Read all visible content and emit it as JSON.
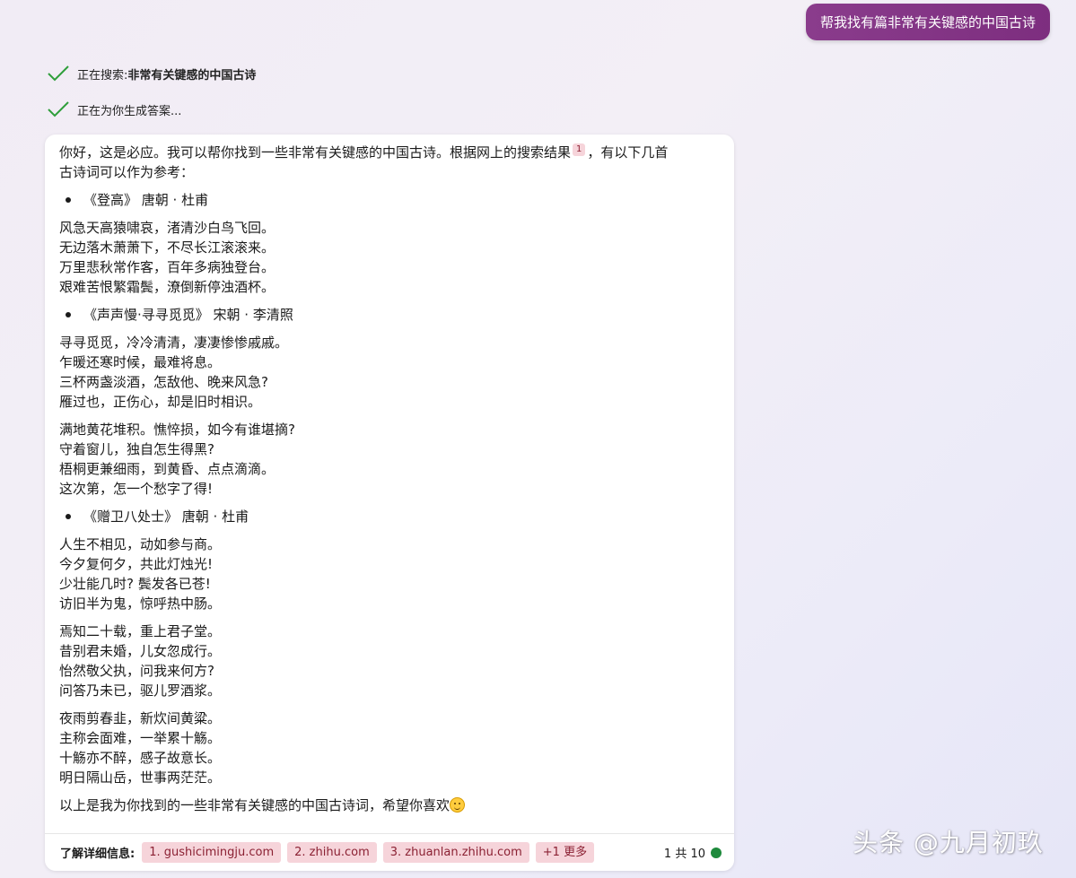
{
  "user_message": "帮我找有篇非常有关键感的中国古诗",
  "status": [
    {
      "prefix": "正在搜索: ",
      "bold": "非常有关键感的中国古诗"
    },
    {
      "prefix": "正在为你生成答案...",
      "bold": ""
    }
  ],
  "answer": {
    "intro_a": "你好，这是必应。我可以帮你找到一些非常有关键感的中国古诗。根据网上的搜索结果",
    "intro_ref": "1",
    "intro_b": "，有以下几首",
    "intro_c": "古诗词可以作为参考：",
    "poems": [
      {
        "heading": "《登高》 唐朝 · 杜甫",
        "stanzas": [
          [
            "风急天高猿啸哀，渚清沙白鸟飞回。",
            "无边落木萧萧下，不尽长江滚滚来。",
            "万里悲秋常作客，百年多病独登台。",
            "艰难苦恨繁霜鬓，潦倒新停浊酒杯。"
          ]
        ]
      },
      {
        "heading": "《声声慢·寻寻觅觅》 宋朝 · 李清照",
        "stanzas": [
          [
            "寻寻觅觅，冷冷清清，凄凄惨惨戚戚。",
            "乍暖还寒时候，最难将息。",
            "三杯两盏淡酒，怎敌他、晚来风急?",
            "雁过也，正伤心，却是旧时相识。"
          ],
          [
            "满地黄花堆积。憔悴损，如今有谁堪摘?",
            "守着窗儿，独自怎生得黑?",
            "梧桐更兼细雨，到黄昏、点点滴滴。",
            "这次第，怎一个愁字了得!"
          ]
        ]
      },
      {
        "heading": "《赠卫八处士》 唐朝 · 杜甫",
        "stanzas": [
          [
            "人生不相见，动如参与商。",
            "今夕复何夕，共此灯烛光!",
            "少壮能几时? 鬓发各已苍!",
            "访旧半为鬼，惊呼热中肠。"
          ],
          [
            "焉知二十载，重上君子堂。",
            "昔别君未婚，儿女忽成行。",
            "怡然敬父执，问我来何方?",
            "问答乃未已，驱儿罗酒浆。"
          ],
          [
            "夜雨剪春韭，新炊间黄粱。",
            "主称会面难，一举累十觞。",
            "十觞亦不醉，感子故意长。",
            "明日隔山岳，世事两茫茫。"
          ]
        ]
      }
    ],
    "closing": "以上是我为你找到的一些非常有关键感的中国古诗词，希望你喜欢"
  },
  "footer": {
    "label": "了解详细信息:",
    "sources": [
      "1. gushicimingju.com",
      "2. zhihu.com",
      "3. zhuanlan.zhihu.com",
      "+1 更多"
    ],
    "count": "1 共 10"
  },
  "watermark": "头条 @九月初玖",
  "colors": {
    "accent": "#8a3c8c",
    "chip_bg": "#f6d4da",
    "chip_text": "#8b2133",
    "status_dot": "#1e8a3c",
    "check": "#2e9e3a"
  }
}
